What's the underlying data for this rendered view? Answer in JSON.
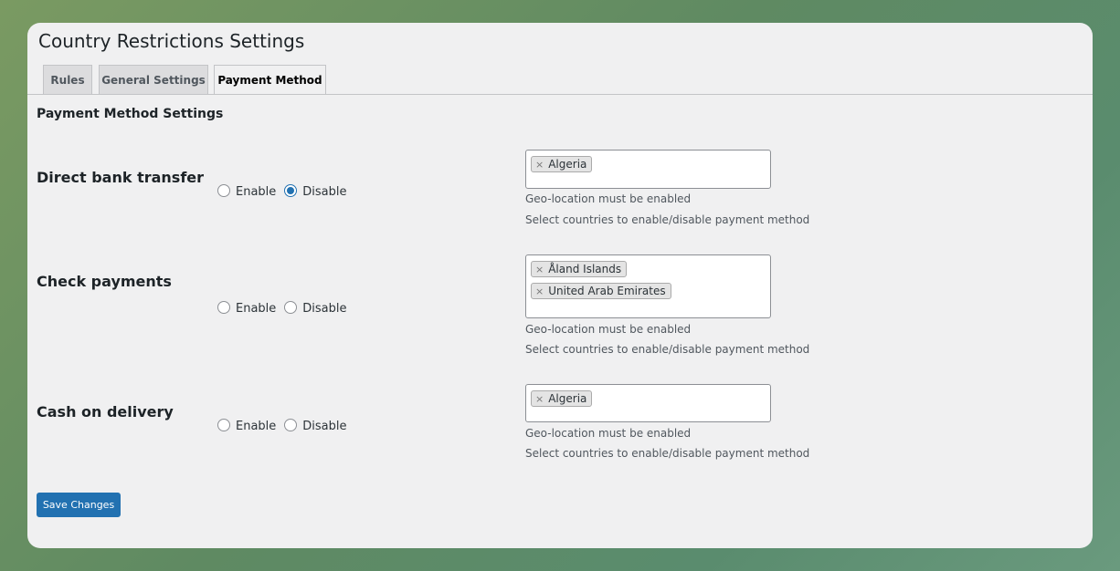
{
  "page": {
    "title": "Country Restrictions Settings"
  },
  "tabs": [
    {
      "label": "Rules",
      "active": false
    },
    {
      "label": "General Settings",
      "active": false
    },
    {
      "label": "Payment Method",
      "active": true
    }
  ],
  "section": {
    "heading": "Payment Method Settings"
  },
  "radio_labels": {
    "enable": "Enable",
    "disable": "Disable"
  },
  "methods": [
    {
      "name": "Direct bank transfer",
      "selected": "Disable",
      "countries": [
        "Algeria"
      ],
      "note": "Geo-location must be enabled",
      "help": "Select countries to enable/disable payment method"
    },
    {
      "name": "Check payments",
      "selected": "",
      "countries": [
        "Åland Islands",
        "United Arab Emirates"
      ],
      "note": "Geo-location must be enabled",
      "help": "Select countries to enable/disable payment method"
    },
    {
      "name": "Cash on delivery",
      "selected": "",
      "countries": [
        "Algeria"
      ],
      "note": "Geo-location must be enabled",
      "help": "Select countries to enable/disable payment method"
    }
  ],
  "chip_remove_glyph": "×",
  "save_label": "Save Changes",
  "colors": {
    "accent": "#2271b1",
    "background": "#f0f0f1"
  }
}
